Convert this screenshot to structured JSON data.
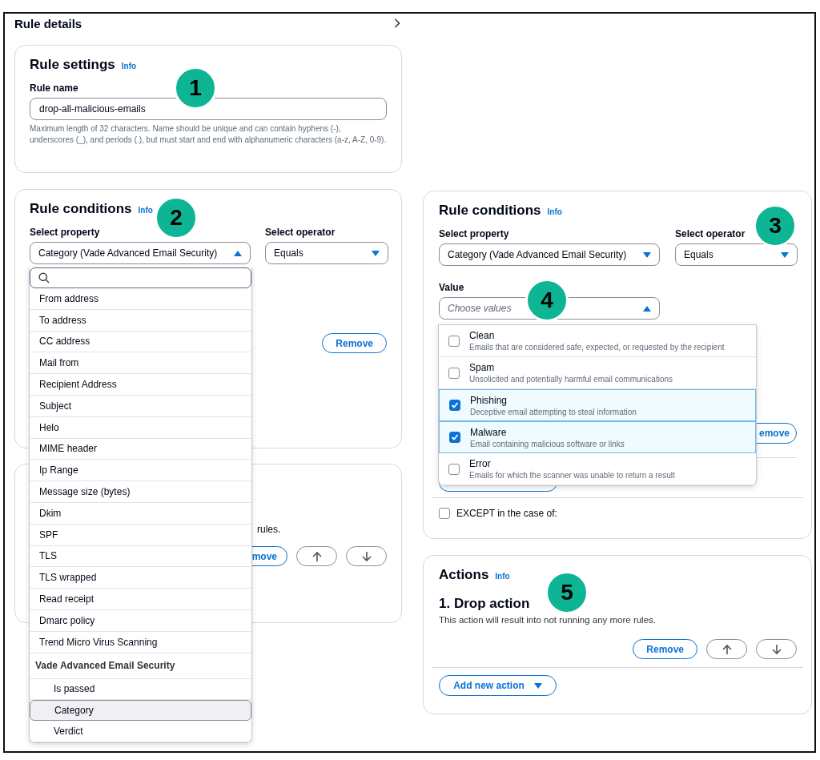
{
  "panel": {
    "title": "Rule details"
  },
  "rule_settings": {
    "title": "Rule settings",
    "info": "Info",
    "name_label": "Rule name",
    "name_value": "drop-all-malicious-emails",
    "hint": "Maximum length of 32 characters. Name should be unique and can contain hyphens (-), underscores (_), and periods (.), but must start and end with alphanumeric characters (a-z, A-Z, 0-9)."
  },
  "rule_conditions_left": {
    "title": "Rule conditions",
    "info": "Info",
    "property_label": "Select property",
    "property_value": "Category (Vade Advanced Email Security)",
    "property_expanded": true,
    "operator_label": "Select operator",
    "operator_value": "Equals",
    "operator_expanded": false,
    "remove_button": "Remove",
    "property_menu": {
      "options": [
        {
          "label": "From address",
          "selected": false
        },
        {
          "label": "To address",
          "selected": false
        },
        {
          "label": "CC address",
          "selected": false
        },
        {
          "label": "Mail from",
          "selected": false
        },
        {
          "label": "Recipient Address",
          "selected": false
        },
        {
          "label": "Subject",
          "selected": false
        },
        {
          "label": "Helo",
          "selected": false
        },
        {
          "label": "MIME header",
          "selected": false
        },
        {
          "label": "Ip Range",
          "selected": false
        },
        {
          "label": "Message size (bytes)",
          "selected": false
        },
        {
          "label": "Dkim",
          "selected": false
        },
        {
          "label": "SPF",
          "selected": false
        },
        {
          "label": "TLS",
          "selected": false
        },
        {
          "label": "TLS wrapped",
          "selected": false
        },
        {
          "label": "Read receipt",
          "selected": false
        },
        {
          "label": "Dmarc policy",
          "selected": false
        },
        {
          "label": "Trend Micro Virus Scanning",
          "selected": false
        }
      ],
      "group": {
        "label": "Vade Advanced Email Security",
        "children": [
          {
            "label": "Is passed",
            "selected": false
          },
          {
            "label": "Category",
            "selected": true
          },
          {
            "label": "Verdict",
            "selected": false
          }
        ]
      }
    }
  },
  "hidden_card": {
    "text": "rules.",
    "remove_button": "move"
  },
  "rule_conditions_right": {
    "title": "Rule conditions",
    "info": "Info",
    "property_label": "Select property",
    "property_value": "Category (Vade Advanced Email Security)",
    "property_expanded": false,
    "operator_label": "Select operator",
    "operator_value": "Equals",
    "operator_expanded": false,
    "value_label": "Value",
    "value_placeholder": "Choose values",
    "value_expanded": true,
    "value_options": [
      {
        "label": "Clean",
        "description": "Emails that are considered safe, expected, or requested by the recipient",
        "checked": false
      },
      {
        "label": "Spam",
        "description": "Unsolicited and potentially harmful email communications",
        "checked": false
      },
      {
        "label": "Phishing",
        "description": "Deceptive email attempting to steal information",
        "checked": true
      },
      {
        "label": "Malware",
        "description": "Email containing malicious software or links",
        "checked": true
      },
      {
        "label": "Error",
        "description": "Emails for which the scanner was unable to return a result",
        "checked": false
      }
    ],
    "remove_button": "emove",
    "except": {
      "label": "EXCEPT in the case of:",
      "checked": false
    }
  },
  "actions": {
    "title": "Actions",
    "info": "Info",
    "action_title": "1. Drop action",
    "action_description": "This action will result into not running any more rules.",
    "remove_button": "Remove",
    "add_button": "Add new action"
  },
  "callouts": [
    "1",
    "2",
    "3",
    "4",
    "5"
  ]
}
